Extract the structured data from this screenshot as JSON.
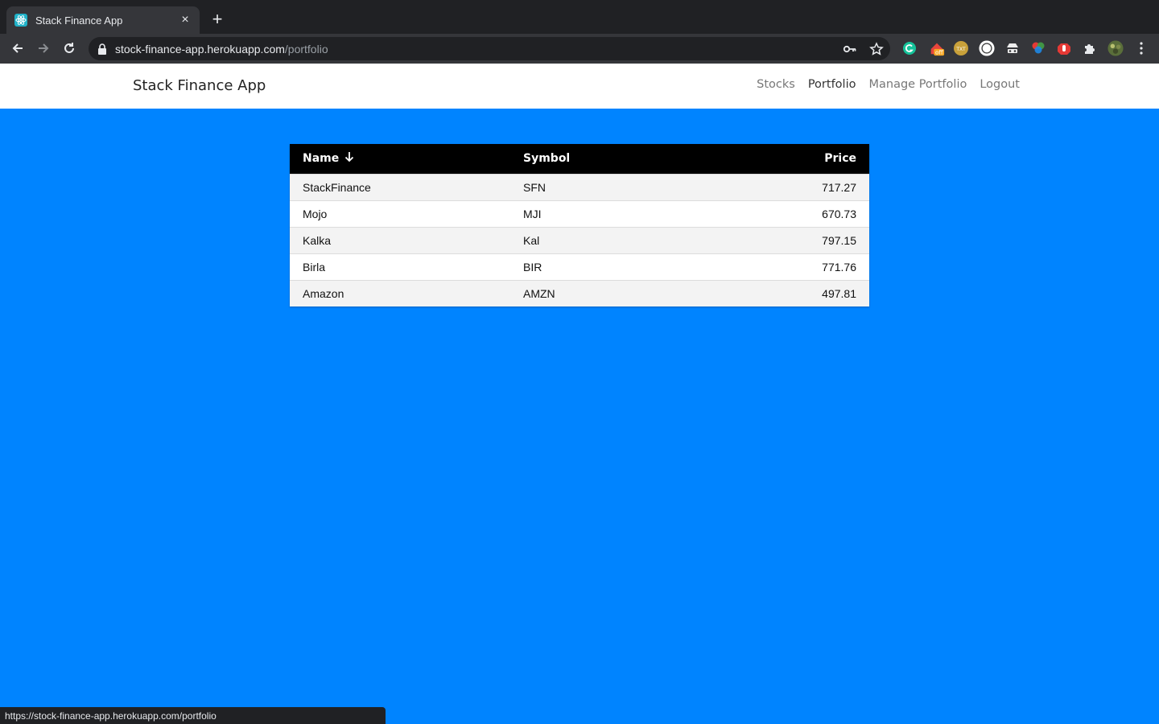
{
  "browser": {
    "tab_title": "Stack Finance App",
    "new_tab_symbol": "+",
    "close_symbol": "×",
    "url_host": "stock-finance-app.herokuapp.com",
    "url_path": "/portfolio",
    "extensions": [
      "grammarly-icon",
      "honey-off-icon",
      "ext-txt-icon",
      "ext-circle-icon",
      "ext-spy-icon",
      "ext-color-icon",
      "ext-hand-icon",
      "puzzle-icon",
      "profile-avatar-icon",
      "menu-dots-icon"
    ],
    "extension_badge": "off",
    "extension_txt": "TXT"
  },
  "navbar": {
    "brand": "Stack Finance App",
    "links": [
      "Stocks",
      "Portfolio",
      "Manage Portfolio",
      "Logout"
    ],
    "active": "Portfolio"
  },
  "table": {
    "headers": [
      "Name",
      "Symbol",
      "Price"
    ],
    "sort_column": "Name",
    "sort_direction": "descending",
    "rows": [
      {
        "name": "StackFinance",
        "symbol": "SFN",
        "price": "717.27"
      },
      {
        "name": "Mojo",
        "symbol": "MJI",
        "price": "670.73"
      },
      {
        "name": "Kalka",
        "symbol": "Kal",
        "price": "797.15"
      },
      {
        "name": "Birla",
        "symbol": "BIR",
        "price": "771.76"
      },
      {
        "name": "Amazon",
        "symbol": "AMZN",
        "price": "497.81"
      }
    ]
  },
  "status_bar": "https://stock-finance-app.herokuapp.com/portfolio",
  "colors": {
    "page_background": "#0084ff",
    "header_background": "#000000",
    "navbar_background": "#ffffff"
  }
}
